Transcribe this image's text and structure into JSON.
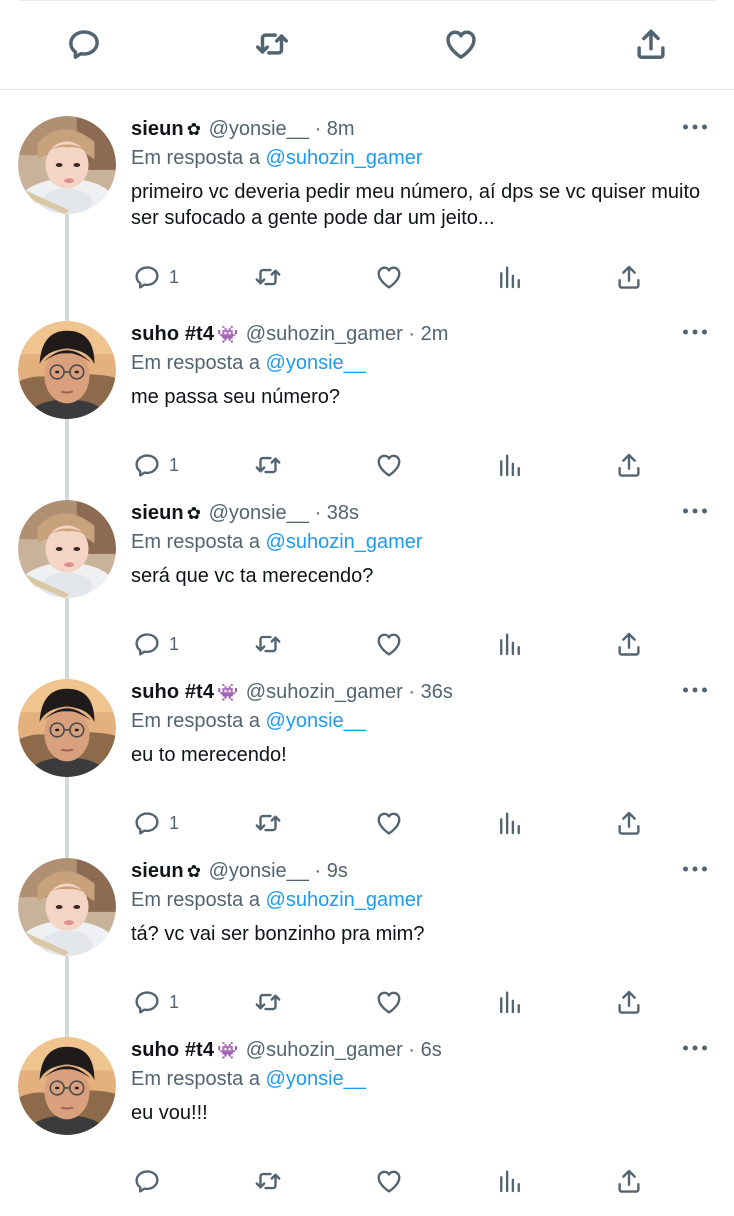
{
  "top_actions": {
    "icons": [
      "reply-icon",
      "retweet-icon",
      "like-icon",
      "share-icon"
    ]
  },
  "reply_prefix": "Em resposta a",
  "more_icon": "ellipsis-icon",
  "tweets": [
    {
      "name": "sieun",
      "badge": "✿",
      "handle": "@yonsie__",
      "dot": "·",
      "time": "8m",
      "reply_to": "@suhozin_gamer",
      "text": "primeiro vc deveria pedir meu número, aí dps se vc quiser muito ser sufocado a gente pode dar um jeito...",
      "reply_count": "1",
      "avatar": "sieun-avatar"
    },
    {
      "name": "suho #t4",
      "badge": "👾",
      "handle": "@suhozin_gamer",
      "dot": "·",
      "time": "2m",
      "reply_to": "@yonsie__",
      "text": "me passa seu número?",
      "reply_count": "1",
      "avatar": "suho-avatar"
    },
    {
      "name": "sieun",
      "badge": "✿",
      "handle": "@yonsie__",
      "dot": "·",
      "time": "38s",
      "reply_to": "@suhozin_gamer",
      "text": "será que vc ta merecendo?",
      "reply_count": "1",
      "avatar": "sieun-avatar"
    },
    {
      "name": "suho #t4",
      "badge": "👾",
      "handle": "@suhozin_gamer",
      "dot": "·",
      "time": "36s",
      "reply_to": "@yonsie__",
      "text": "eu to merecendo!",
      "reply_count": "1",
      "avatar": "suho-avatar"
    },
    {
      "name": "sieun",
      "badge": "✿",
      "handle": "@yonsie__",
      "dot": "·",
      "time": "9s",
      "reply_to": "@suhozin_gamer",
      "text": "tá? vc vai ser bonzinho pra mim?",
      "reply_count": "1",
      "avatar": "sieun-avatar"
    },
    {
      "name": "suho #t4",
      "badge": "👾",
      "handle": "@suhozin_gamer",
      "dot": "·",
      "time": "6s",
      "reply_to": "@yonsie__",
      "text": "eu vou!!!",
      "reply_count": "",
      "avatar": "suho-avatar"
    }
  ],
  "colors": {
    "text": "#0f1419",
    "secondary": "#536471",
    "mention": "#1d9bf0",
    "thread_line": "#d3d9dd"
  }
}
